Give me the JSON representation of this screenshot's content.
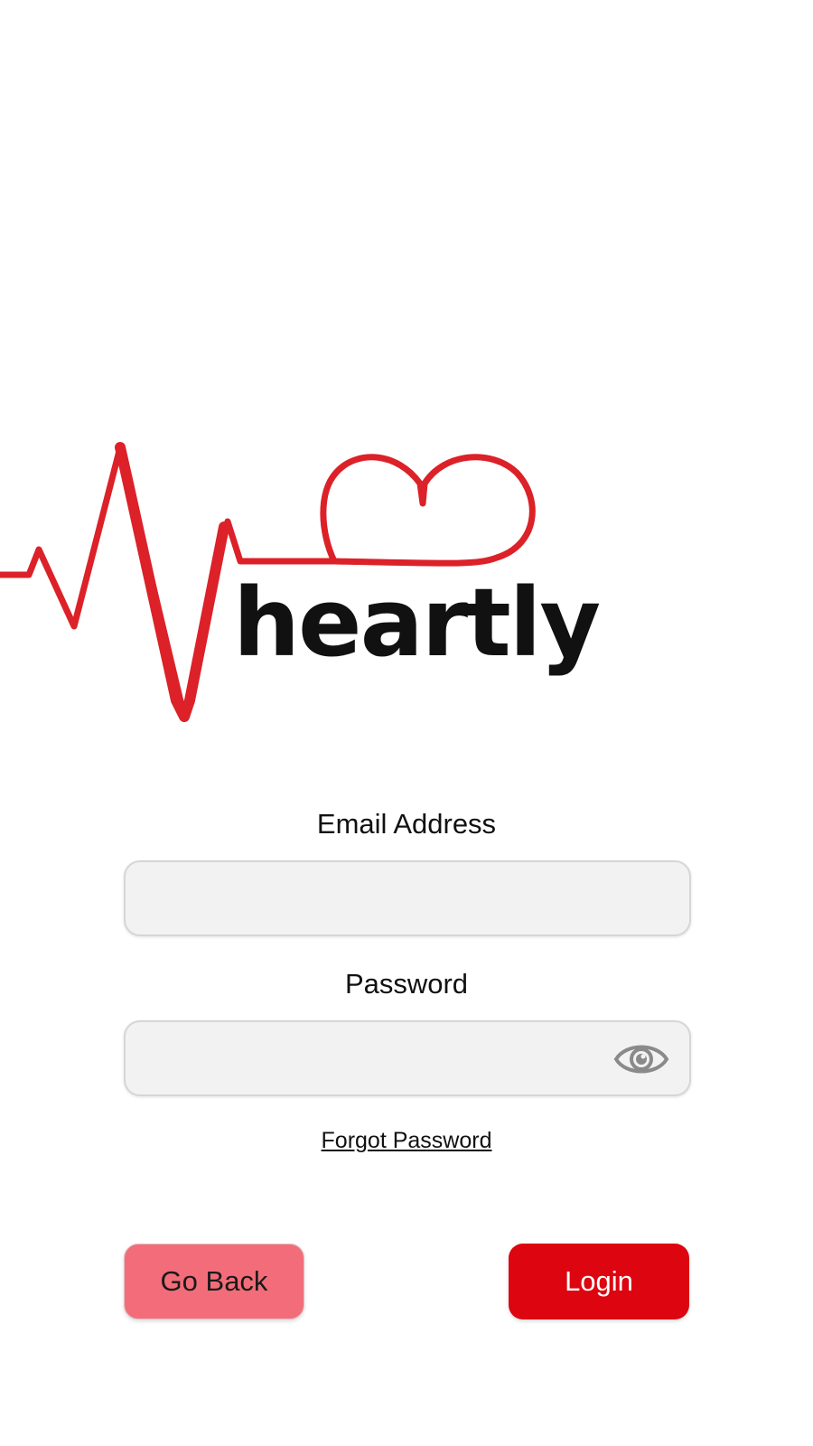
{
  "app": {
    "logo_text": "heartly",
    "brand_color": "#dc2128"
  },
  "form": {
    "email_label": "Email Address",
    "email_value": "",
    "password_label": "Password",
    "password_value": "",
    "forgot_password_label": "Forgot Password",
    "show_password_icon": "eye-icon"
  },
  "actions": {
    "go_back_label": "Go Back",
    "go_back_color": "#f26d79",
    "login_label": "Login",
    "login_color": "#dc0510"
  }
}
